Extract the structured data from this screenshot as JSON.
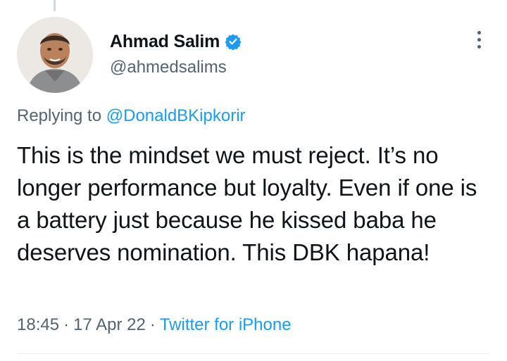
{
  "tweet": {
    "author": {
      "display_name": "Ahmad Salim",
      "handle": "@ahmedsalims",
      "verified": true,
      "avatar_icon": "avatar-photo"
    },
    "reply_prefix": "Replying to ",
    "reply_to": "@DonaldBKipkorir",
    "text": "This is the mindset we must reject. It’s no longer performance but loyalty. Even if one is a battery just because he kissed baba he deserves nomination. This DBK hapana!",
    "time": "18:45",
    "date": "17 Apr 22",
    "separator": "·",
    "source": "Twitter for iPhone",
    "more_icon": "more-horizontal-icon"
  },
  "colors": {
    "text_primary": "#0f1419",
    "text_secondary": "#536471",
    "link": "#1d9bf0",
    "verified": "#1d9bf0",
    "divider": "#eff3f4"
  }
}
